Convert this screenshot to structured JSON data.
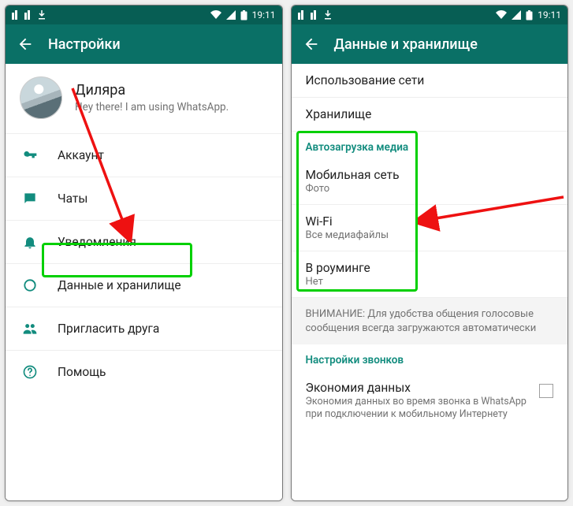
{
  "status": {
    "time": "19:11"
  },
  "left": {
    "title": "Настройки",
    "profile": {
      "name": "Диляра",
      "subtitle": "Hey there! I am using WhatsApp."
    },
    "rows": {
      "account": "Аккаунт",
      "chats": "Чаты",
      "notif": "Уведомления",
      "data": "Данные и хранилище",
      "invite": "Пригласить друга",
      "help": "Помощь"
    }
  },
  "right": {
    "title": "Данные и хранилище",
    "usage": "Использование сети",
    "storage": "Хранилище",
    "autodl_header": "Автозагрузка медиа",
    "mobile": {
      "t": "Мобильная сеть",
      "s": "Фото"
    },
    "wifi": {
      "t": "Wi-Fi",
      "s": "Все медиафайлы"
    },
    "roaming": {
      "t": "В роуминге",
      "s": "Нет"
    },
    "note": "ВНИМАНИЕ: Для удобства общения голосовые сообщения всегда загружаются автоматически",
    "calls_header": "Настройки звонков",
    "lowdata": {
      "t": "Экономия данных",
      "s": "Экономия данных во время звонка в WhatsApp при подключении к мобильному Интернету"
    }
  }
}
